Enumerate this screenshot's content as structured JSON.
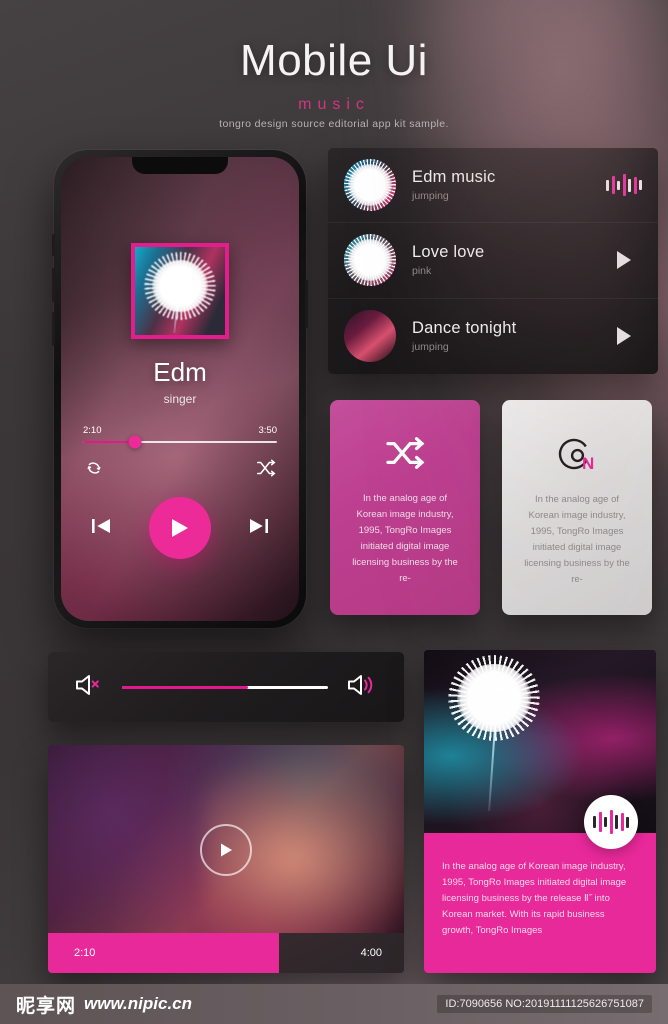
{
  "header": {
    "title": "Mobile Ui",
    "subtitle": "music",
    "description": "tongro design source editorial app kit sample."
  },
  "phone": {
    "album_art_icon": "album-art-dandelion",
    "track_title": "Edm",
    "track_artist": "singer",
    "current_time": "2:10",
    "total_time": "3:50",
    "progress_percent": 27,
    "repeat_icon": "repeat-icon",
    "shuffle_icon": "shuffle-icon",
    "prev_icon": "skip-previous-icon",
    "play_icon": "play-icon",
    "next_icon": "skip-next-icon"
  },
  "playlist": {
    "rows": [
      {
        "title": "Edm music",
        "artist": "jumping",
        "action_icon": "equalizer-icon",
        "thumb": "thumb-a"
      },
      {
        "title": "Love love",
        "artist": "pink",
        "action_icon": "play-icon",
        "thumb": "thumb-b"
      },
      {
        "title": "Dance tonight",
        "artist": "jumping",
        "action_icon": "play-icon",
        "thumb": "thumb-c"
      }
    ]
  },
  "cards": [
    {
      "icon": "shuffle-icon",
      "text": "In the analog age of Korean image industry, 1995, TongRo Images initiated digital image licensing business by the re-"
    },
    {
      "icon": "on-disc-icon",
      "icon_letter": "N",
      "text": "In the analog age of Korean image industry, 1995, TongRo Images initiated digital image licensing business by the re-"
    }
  ],
  "volume": {
    "mute_icon": "volume-mute-icon",
    "up_icon": "volume-up-icon",
    "level_percent": 61
  },
  "video": {
    "play_icon": "play-circle-icon",
    "current_time": "2:10",
    "total_time": "4:00",
    "progress_percent": 65
  },
  "photo_card": {
    "badge_icon": "equalizer-icon",
    "text": "In the analog age of Korean image industry, 1995, TongRo Images initiated digital image licensing business by the release Ⅱ˝ into Korean market. With its rapid business growth, TongRo Images"
  },
  "footer": {
    "logo": "昵享网",
    "site": "www.nipic.cn",
    "id_text": "ID:7090656 NO:20191111125626751087"
  },
  "colors": {
    "accent_pink": "#e8299a",
    "deep_pink": "#e3188c",
    "card_pink": "#bd3f90",
    "dark_panel": "#201d1f"
  }
}
